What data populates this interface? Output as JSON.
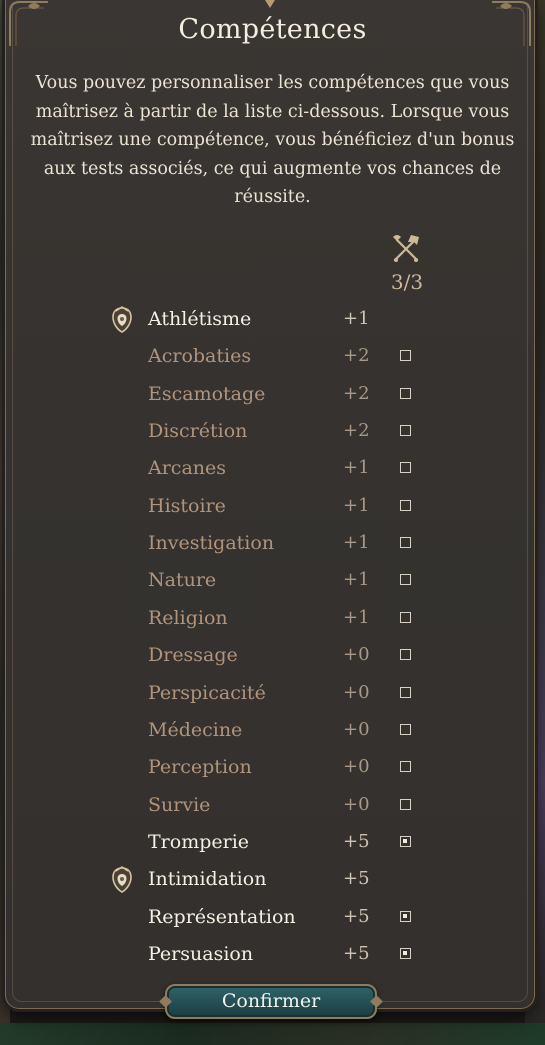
{
  "dialog": {
    "title": "Compétences",
    "description": "Vous pouvez personnaliser les compétences que vous maîtrisez à partir de la liste ci-dessous. Lorsque vous maîtrisez une compétence, vous bénéficiez d'un bonus aux tests associés, ce qui augmente vos chances de réussite.",
    "counter": "3/3",
    "header_icon": "crossed-tools-icon"
  },
  "skills": [
    {
      "name": "Athlétisme",
      "bonus": "+1",
      "proficient": true,
      "source": "badge"
    },
    {
      "name": "Acrobaties",
      "bonus": "+2",
      "proficient": false,
      "source": "checkbox"
    },
    {
      "name": "Escamotage",
      "bonus": "+2",
      "proficient": false,
      "source": "checkbox"
    },
    {
      "name": "Discrétion",
      "bonus": "+2",
      "proficient": false,
      "source": "checkbox"
    },
    {
      "name": "Arcanes",
      "bonus": "+1",
      "proficient": false,
      "source": "checkbox"
    },
    {
      "name": "Histoire",
      "bonus": "+1",
      "proficient": false,
      "source": "checkbox"
    },
    {
      "name": "Investigation",
      "bonus": "+1",
      "proficient": false,
      "source": "checkbox"
    },
    {
      "name": "Nature",
      "bonus": "+1",
      "proficient": false,
      "source": "checkbox"
    },
    {
      "name": "Religion",
      "bonus": "+1",
      "proficient": false,
      "source": "checkbox"
    },
    {
      "name": "Dressage",
      "bonus": "+0",
      "proficient": false,
      "source": "checkbox"
    },
    {
      "name": "Perspicacité",
      "bonus": "+0",
      "proficient": false,
      "source": "checkbox"
    },
    {
      "name": "Médecine",
      "bonus": "+0",
      "proficient": false,
      "source": "checkbox"
    },
    {
      "name": "Perception",
      "bonus": "+0",
      "proficient": false,
      "source": "checkbox"
    },
    {
      "name": "Survie",
      "bonus": "+0",
      "proficient": false,
      "source": "checkbox"
    },
    {
      "name": "Tromperie",
      "bonus": "+5",
      "proficient": true,
      "source": "checkbox"
    },
    {
      "name": "Intimidation",
      "bonus": "+5",
      "proficient": true,
      "source": "badge"
    },
    {
      "name": "Représentation",
      "bonus": "+5",
      "proficient": true,
      "source": "checkbox"
    },
    {
      "name": "Persuasion",
      "bonus": "+5",
      "proficient": true,
      "source": "checkbox"
    }
  ],
  "confirm_button": {
    "label": "Confirmer"
  },
  "icons": {
    "badge": "background-proficiency-icon",
    "checkbox_checked": "checkbox-checked",
    "checkbox_empty": "checkbox-empty"
  },
  "colors": {
    "accent_gold": "#cdb99a",
    "button_teal": "#2f6468",
    "skill_muted": "#b0957a",
    "skill_active": "#f5efe4"
  }
}
